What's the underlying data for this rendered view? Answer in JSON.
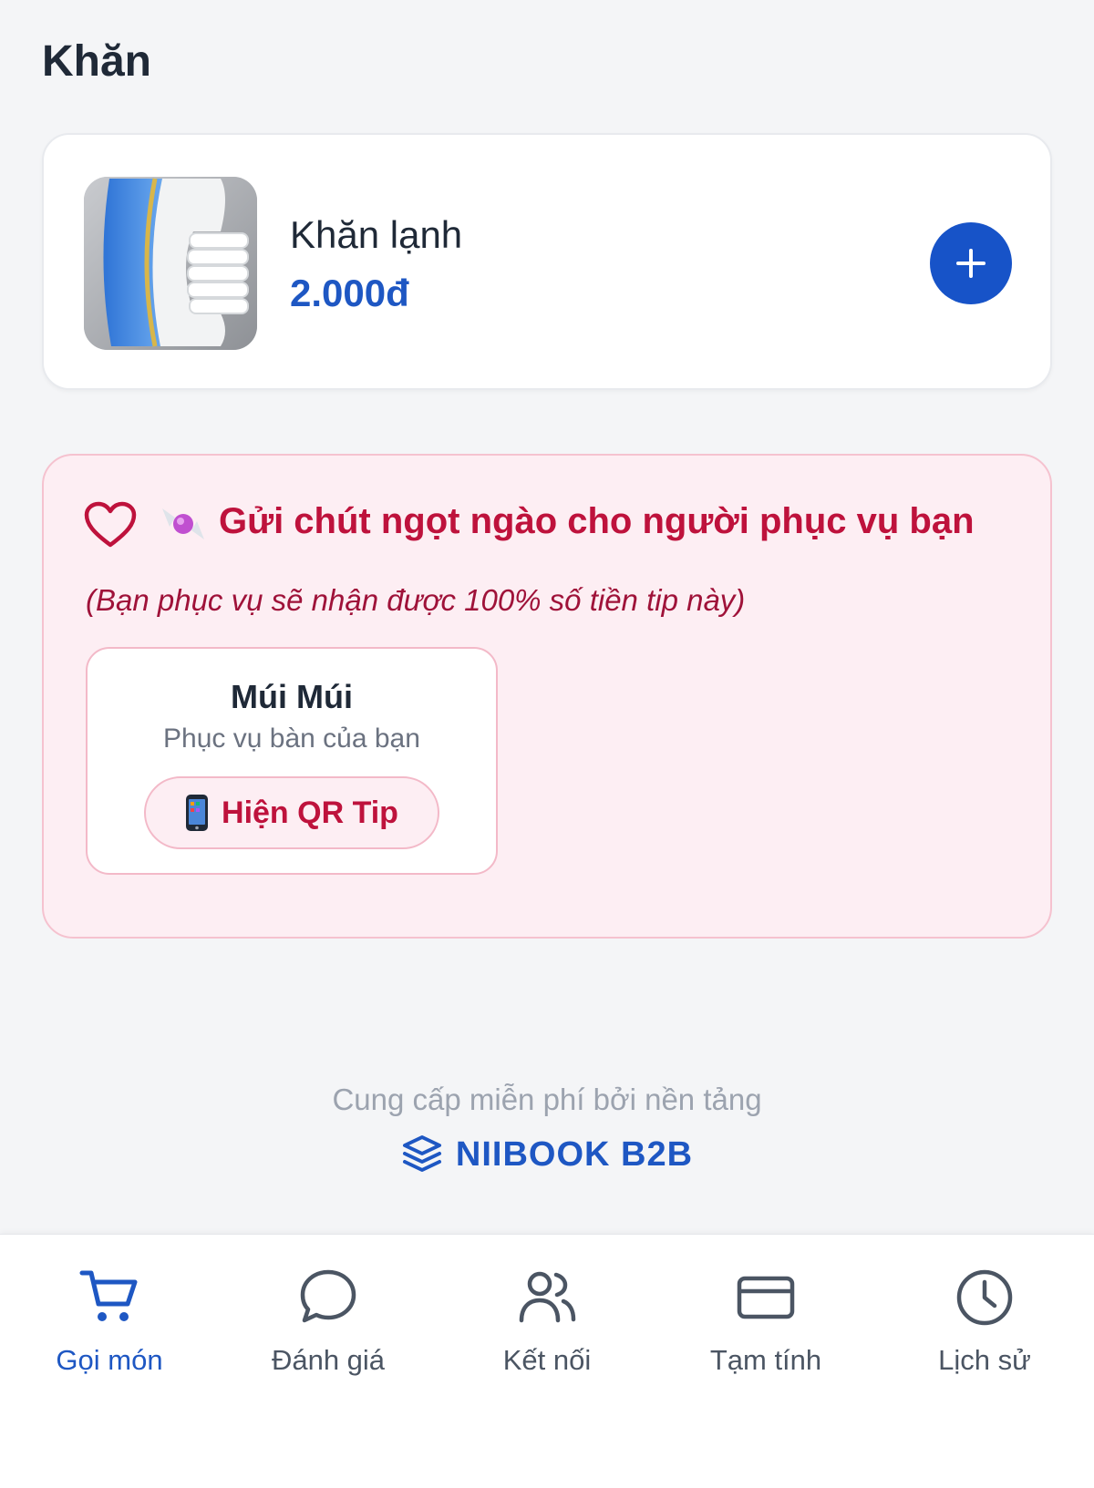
{
  "section": {
    "title": "Khăn"
  },
  "product": {
    "name": "Khăn lạnh",
    "price": "2.000đ",
    "add_icon": "plus-icon"
  },
  "tip": {
    "title": "Gửi chút ngọt ngào cho người phục vụ bạn",
    "subtitle": "(Bạn phục vụ sẽ nhận được 100% số tiền tip này)",
    "waiter_name": "Múi Múi",
    "waiter_role": "Phục vụ bàn của bạn",
    "qr_button": "Hiện QR Tip",
    "icons": [
      "heart-icon",
      "candy-icon",
      "phone-icon"
    ]
  },
  "footer": {
    "provided_by": "Cung cấp miễn phí bởi nền tảng",
    "brand": "NIIBOOK B2B"
  },
  "nav": [
    {
      "label": "Gọi món",
      "icon": "cart-icon",
      "active": true
    },
    {
      "label": "Đánh giá",
      "icon": "chat-icon",
      "active": false
    },
    {
      "label": "Kết nối",
      "icon": "users-icon",
      "active": false
    },
    {
      "label": "Tạm tính",
      "icon": "card-icon",
      "active": false
    },
    {
      "label": "Lịch sử",
      "icon": "clock-icon",
      "active": false
    }
  ],
  "colors": {
    "accent": "#1e57c3",
    "tip_accent": "#be123c",
    "tip_background": "#fdeef3",
    "page_background": "#f4f5f7"
  }
}
